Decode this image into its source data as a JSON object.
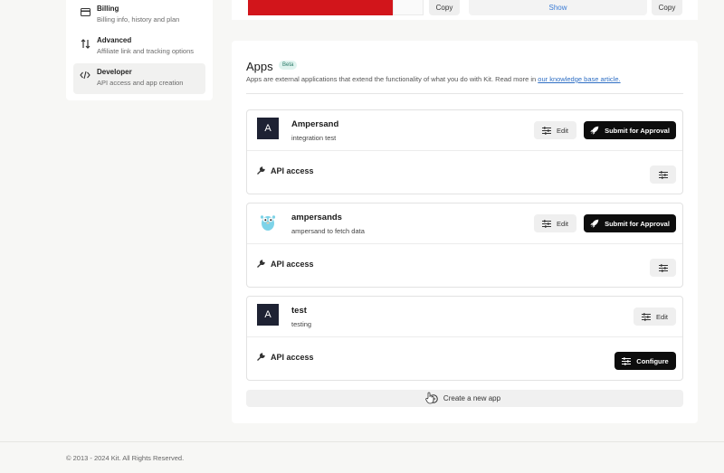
{
  "sidebar": {
    "items": [
      {
        "title": "Billing",
        "subtitle": "Billing info, history and plan",
        "icon": "credit-card-icon"
      },
      {
        "title": "Advanced",
        "subtitle": "Affiliate link and tracking options",
        "icon": "arrows-swap-icon"
      },
      {
        "title": "Developer",
        "subtitle": "API access and app creation",
        "icon": "code-icon",
        "active": true
      }
    ]
  },
  "top_strip": {
    "copy_label_1": "Copy",
    "show_label": "Show",
    "copy_label_2": "Copy"
  },
  "apps": {
    "title": "Apps",
    "badge": "Beta",
    "description": "Apps are external applications that extend the functionality of what you do with Kit. Read more in ",
    "link_text": "our knowledge base article.",
    "list": [
      {
        "name": "Ampersand",
        "subtitle": "integration test",
        "avatar": "A",
        "edit_label": "Edit",
        "submit_label": "Submit for Approval",
        "api_label": "API access"
      },
      {
        "name": "ampersands",
        "subtitle": "ampersand to fetch data",
        "avatar": "gopher",
        "edit_label": "Edit",
        "submit_label": "Submit for Approval",
        "api_label": "API access"
      },
      {
        "name": "test",
        "subtitle": "testing",
        "avatar": "A",
        "edit_label": "Edit",
        "api_label": "API access",
        "configure_label": "Configure"
      }
    ],
    "create_label": "Create a new app"
  },
  "footer": {
    "text": "© 2013 - 2024 Kit. All Rights Reserved."
  },
  "colors": {
    "accent_red": "#d2151b",
    "primary_black": "#0d0d0d",
    "link_blue": "#2f6fc4",
    "badge_bg": "#dff3ee"
  }
}
